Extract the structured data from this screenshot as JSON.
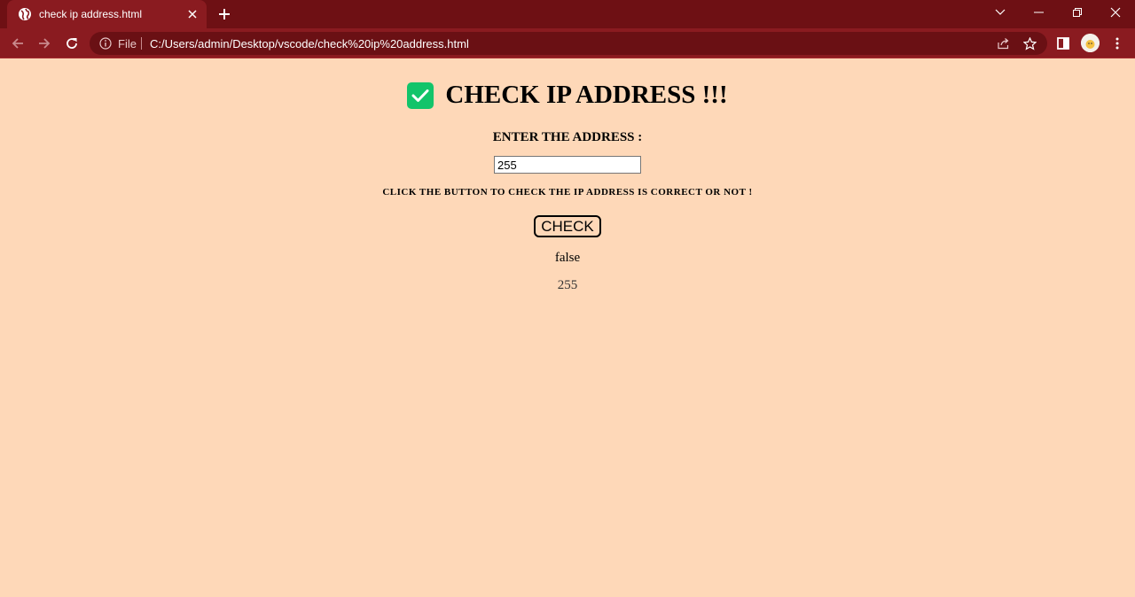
{
  "browser": {
    "tab_title": "check ip address.html",
    "omnibox": {
      "scheme_label": "File",
      "url": "C:/Users/admin/Desktop/vscode/check%20ip%20address.html"
    }
  },
  "colors": {
    "page_background": "#fed8b8",
    "chrome_tabbar": "#6e1014",
    "chrome_toolbar": "#8a1b20",
    "check_emoji": "#12c46a"
  },
  "icons": {
    "tab": "globe-icon",
    "tab_close": "close-icon",
    "new_tab": "plus-icon",
    "heading": "check-mark-button-icon"
  },
  "page": {
    "heading": "CHECK IP ADDRESS !!!",
    "enter_label": "ENTER THE ADDRESS :",
    "input_value": "255",
    "instruction": "CLICK THE BUTTON TO CHECK THE IP ADDRESS IS CORRECT OR NOT !",
    "button_label": "CHECK",
    "result": "false",
    "echo": "255"
  }
}
